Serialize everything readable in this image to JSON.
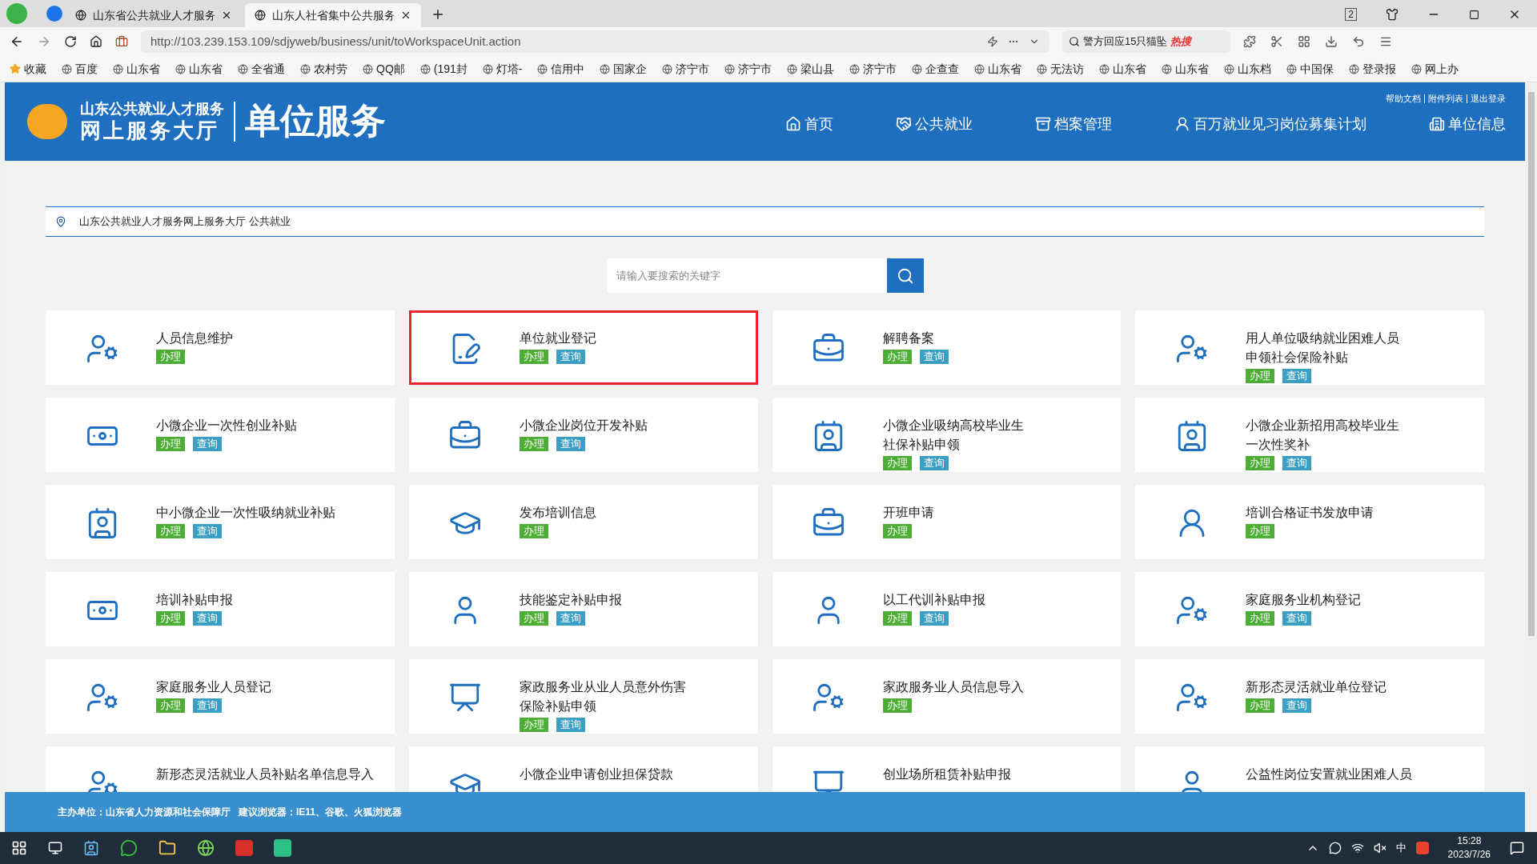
{
  "browser": {
    "tabs": [
      {
        "title": "山东省公共就业人才服务",
        "selected": false
      },
      {
        "title": "山东人社省集中公共服务",
        "selected": true
      }
    ],
    "address": "http://103.239.153.109/sdjyweb/business/unit/toWorkspaceUnit.action",
    "search": {
      "value": "警方回应15只猫坠",
      "badge": "热搜"
    },
    "download_count": "2",
    "bookmarks": [
      "收藏",
      "百度",
      "山东省",
      "山东省",
      "全省通",
      "农村劳",
      "QQ邮",
      "(191封",
      "灯塔-",
      "信用中",
      "国家企",
      "济宁市",
      "济宁市",
      "梁山县",
      "济宁市",
      "企查查",
      "山东省",
      "无法访",
      "山东省",
      "山东省",
      "山东档",
      "中国保",
      "登录报",
      "网上办"
    ]
  },
  "header": {
    "logo_line1": "山东公共就业人才服务",
    "logo_line2": "网上服务大厅",
    "title": "单位服务",
    "links": [
      "帮助文档",
      "附件列表",
      "退出登录"
    ],
    "nav": [
      {
        "label": "首页",
        "kind": "home"
      },
      {
        "label": "公共就业",
        "kind": "handshake"
      },
      {
        "label": "档案管理",
        "kind": "archive"
      },
      {
        "label": "百万就业见习岗位募集计划",
        "kind": "person"
      },
      {
        "label": "单位信息",
        "kind": "building"
      }
    ]
  },
  "breadcrumb": "山东公共就业人才服务网上服务大厅 公共就业",
  "search": {
    "placeholder": "请输入要搜索的关键字"
  },
  "cards": [
    {
      "title": [
        "人员信息维护"
      ],
      "kind": "user",
      "highlighted": false,
      "actions": [
        "办理"
      ]
    },
    {
      "title": [
        "单位就业登记"
      ],
      "kind": "form",
      "highlighted": true,
      "actions": [
        "办理",
        "查询"
      ]
    },
    {
      "title": [
        "解聘备案"
      ],
      "kind": "briefcase",
      "highlighted": false,
      "actions": [
        "办理",
        "查询"
      ]
    },
    {
      "title": [
        "用人单位吸纳就业困难人员",
        "申领社会保险补贴"
      ],
      "kind": "user",
      "highlighted": false,
      "actions": [
        "办理",
        "查询"
      ]
    },
    {
      "title": [
        "小微企业一次性创业补贴"
      ],
      "kind": "money",
      "highlighted": false,
      "actions": [
        "办理",
        "查询"
      ]
    },
    {
      "title": [
        "小微企业岗位开发补贴"
      ],
      "kind": "briefcase",
      "highlighted": false,
      "actions": [
        "办理",
        "查询"
      ]
    },
    {
      "title": [
        "小微企业吸纳高校毕业生",
        "社保补贴申领"
      ],
      "kind": "idcard",
      "highlighted": false,
      "actions": [
        "办理",
        "查询"
      ]
    },
    {
      "title": [
        "小微企业新招用高校毕业生",
        "一次性奖补"
      ],
      "kind": "idcard",
      "highlighted": false,
      "actions": [
        "办理",
        "查询"
      ]
    },
    {
      "title": [
        "中小微企业一次性吸纳就业补贴"
      ],
      "kind": "idcard",
      "highlighted": false,
      "actions": [
        "办理",
        "查询"
      ]
    },
    {
      "title": [
        "发布培训信息"
      ],
      "kind": "hat",
      "highlighted": false,
      "actions": [
        "办理"
      ]
    },
    {
      "title": [
        "开班申请"
      ],
      "kind": "briefcase",
      "highlighted": false,
      "actions": [
        "办理"
      ]
    },
    {
      "title": [
        "培训合格证书发放申请"
      ],
      "kind": "teacher",
      "highlighted": false,
      "actions": [
        "办理"
      ]
    },
    {
      "title": [
        "培训补贴申报"
      ],
      "kind": "money",
      "highlighted": false,
      "actions": [
        "办理",
        "查询"
      ]
    },
    {
      "title": [
        "技能鉴定补贴申报"
      ],
      "kind": "outline",
      "highlighted": false,
      "actions": [
        "办理",
        "查询"
      ]
    },
    {
      "title": [
        "以工代训补贴申报"
      ],
      "kind": "outline",
      "highlighted": false,
      "actions": [
        "办理",
        "查询"
      ]
    },
    {
      "title": [
        "家庭服务业机构登记"
      ],
      "kind": "user",
      "highlighted": false,
      "actions": [
        "办理",
        "查询"
      ]
    },
    {
      "title": [
        "家庭服务业人员登记"
      ],
      "kind": "user",
      "highlighted": false,
      "actions": [
        "办理",
        "查询"
      ]
    },
    {
      "title": [
        "家政服务业从业人员意外伤害",
        "保险补贴申领"
      ],
      "kind": "board",
      "highlighted": false,
      "actions": [
        "办理",
        "查询"
      ]
    },
    {
      "title": [
        "家政服务业人员信息导入"
      ],
      "kind": "user",
      "highlighted": false,
      "actions": [
        "办理"
      ]
    },
    {
      "title": [
        "新形态灵活就业单位登记"
      ],
      "kind": "user",
      "highlighted": false,
      "actions": [
        "办理",
        "查询"
      ]
    },
    {
      "title": [
        "新形态灵活就业人员补贴名单信息导入"
      ],
      "kind": "user",
      "highlighted": false
    },
    {
      "title": [
        "小微企业申请创业担保贷款"
      ],
      "kind": "hat",
      "highlighted": false
    },
    {
      "title": [
        "创业场所租赁补贴申报"
      ],
      "kind": "board",
      "highlighted": false
    },
    {
      "title": [
        "公益性岗位安置就业困难人员"
      ],
      "kind": "outline",
      "highlighted": false
    }
  ],
  "footer": "主办单位：山东省人力资源和社会保障厅   建议浏览器：IE11、谷歌、火狐浏览器",
  "taskbar": {
    "ime": "中",
    "time": "15:28",
    "date": "2023/7/26"
  }
}
